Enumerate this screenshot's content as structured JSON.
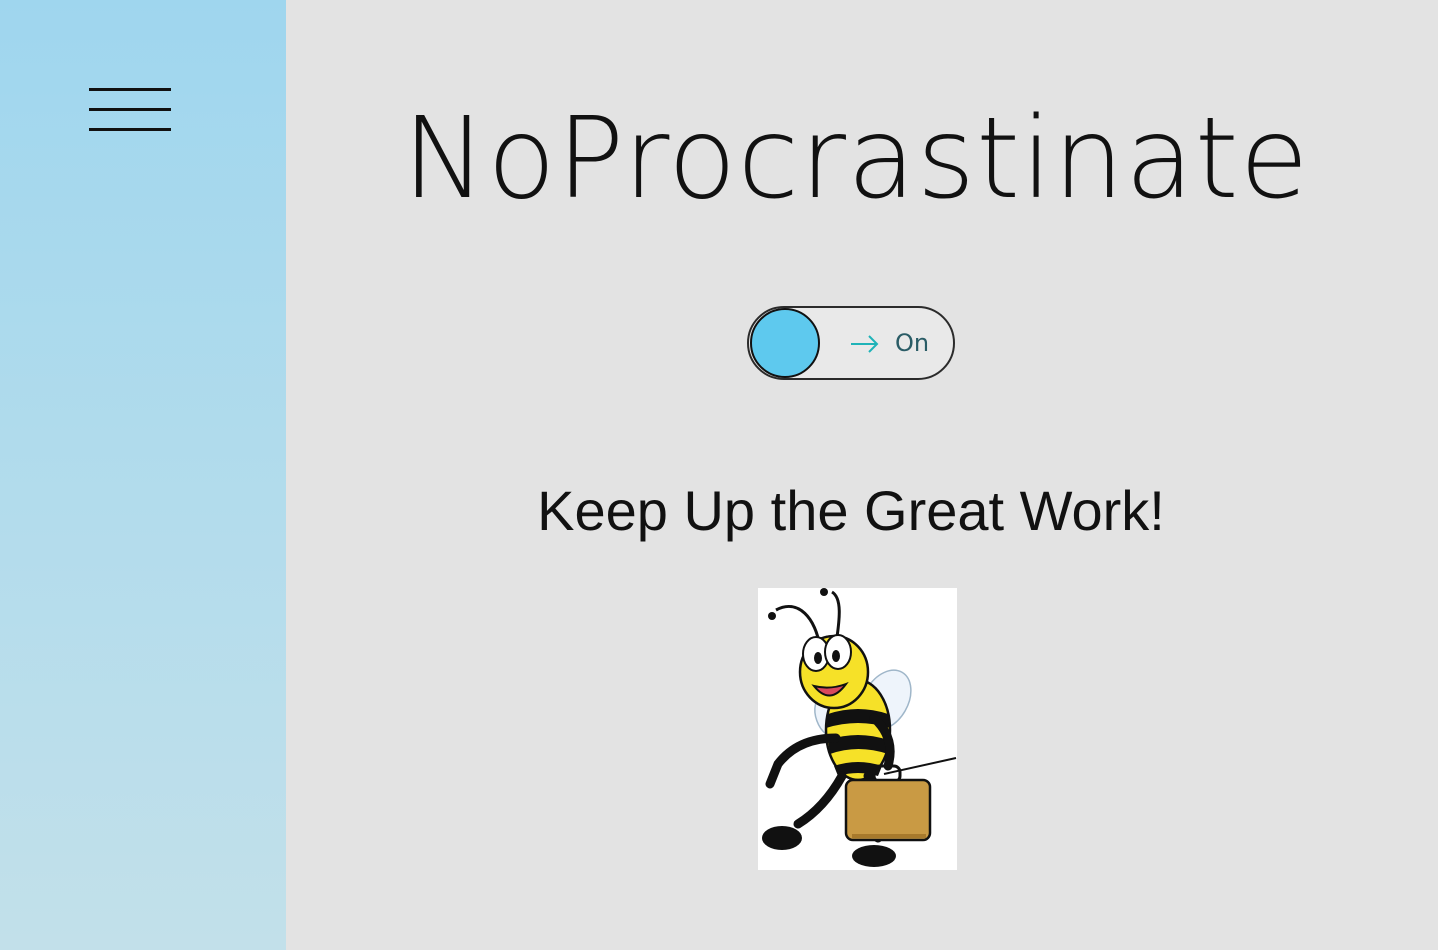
{
  "sidebar": {
    "menu_icon": "hamburger-menu-icon",
    "background": "#a9d9ee"
  },
  "header": {
    "title": "NoProcrastinate"
  },
  "toggle": {
    "state": "on",
    "label": "On",
    "arrow_icon": "arrow-right-icon",
    "knob_color": "#5ec9ee",
    "arrow_color": "#1fb3b8"
  },
  "main": {
    "message": "Keep Up the Great Work!",
    "mascot": "bee-mascot-with-briefcase"
  },
  "colors": {
    "page_background": "#e3e3e3",
    "sidebar": "#a9d9ee"
  }
}
